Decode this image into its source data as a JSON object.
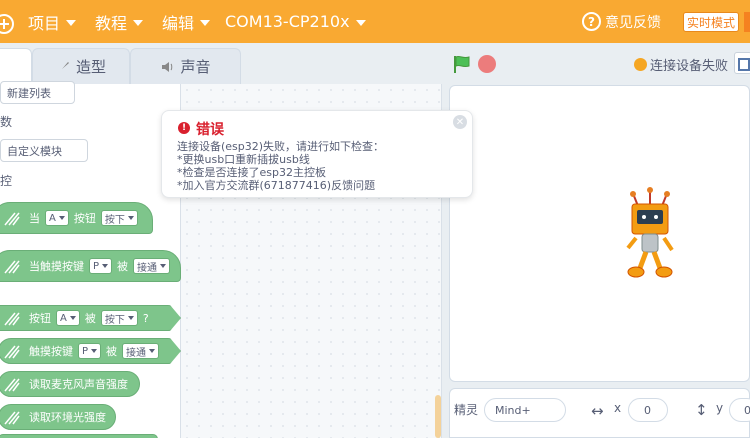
{
  "menubar": {
    "items": [
      "项目",
      "教程",
      "编辑"
    ],
    "device": "COM13-CP210x",
    "feedback": "意见反馈",
    "mode": "实时模式"
  },
  "tabs": {
    "costumes": "造型",
    "sounds": "声音"
  },
  "palette": {
    "make_list": "新建列表",
    "cat_data_partial": "数",
    "make_block": "自定义模块",
    "cat_control_partial": "控",
    "blocks": [
      {
        "text1": "当",
        "drop1": "A",
        "text2": "按钮",
        "drop2": "按下"
      },
      {
        "text1": "当触摸按键",
        "drop1": "P",
        "text2": "被",
        "drop2": "接通"
      },
      {
        "text1": "按钮",
        "drop1": "A",
        "text2": "被",
        "drop2": "按下",
        "tail": "?"
      },
      {
        "text1": "触摸按键",
        "drop1": "P",
        "text2": "被",
        "drop2": "接通"
      },
      {
        "text1": "读取麦克风声音强度"
      },
      {
        "text1": "读取环境光强度"
      }
    ]
  },
  "stage_header": {
    "connection": "连接设备失败"
  },
  "sprite_info": {
    "label": "精灵",
    "name": "Mind+",
    "x_label": "x",
    "x_value": "0",
    "y_label": "y",
    "y_value": "0"
  },
  "error": {
    "title": "错误",
    "lines": [
      "连接设备(esp32)失败，请进行如下检查：",
      "*更换usb口重新插拔usb线",
      "*检查是否连接了esp32主控板",
      "*加入官方交流群(671877416)反馈问题"
    ]
  },
  "colors": {
    "menubar": "#f9a932",
    "block_green": "#7ec58b",
    "error_red": "#d9202e",
    "status_dot": "#f5a623"
  },
  "icons": [
    "add-icon",
    "brush-icon",
    "speaker-icon",
    "question-icon",
    "green-flag-icon",
    "stop-icon",
    "layout-icon",
    "error-icon",
    "close-icon",
    "arrows-horizontal-icon",
    "arrows-vertical-icon",
    "block-icon"
  ]
}
